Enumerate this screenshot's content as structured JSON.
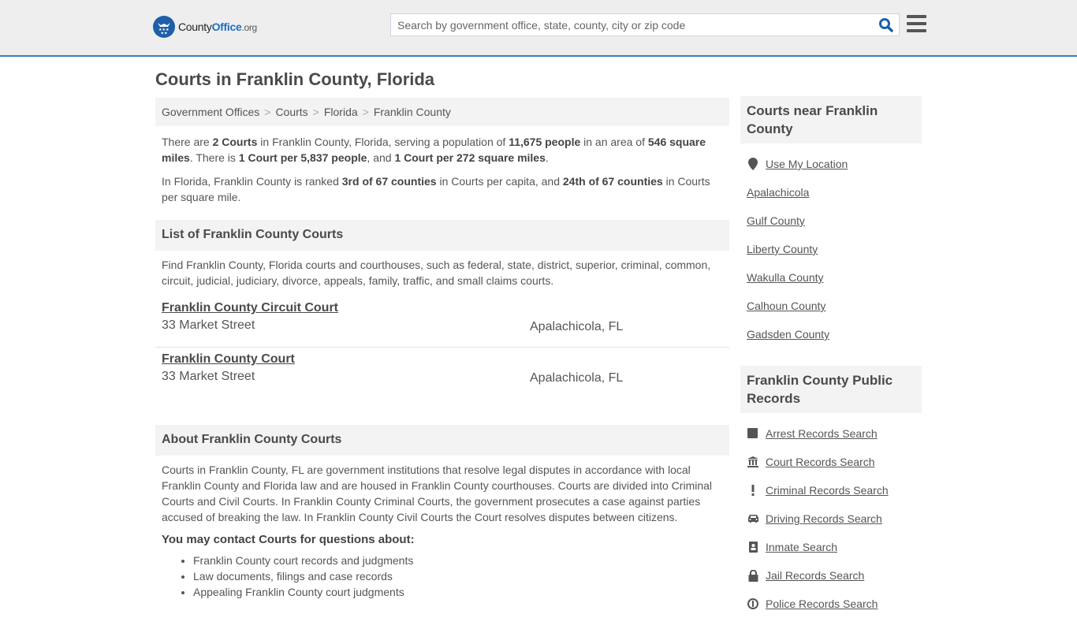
{
  "header": {
    "logo": {
      "part1": "County",
      "part2": "Office",
      "part3": ".org",
      "icon": "eagle-stars-icon",
      "brand_color": "#1d5fa8"
    },
    "search": {
      "placeholder": "Search by government office, state, county, city or zip code",
      "value": "",
      "icon": "search-icon"
    },
    "menu_icon": "hamburger-menu-icon",
    "border_color": "#3a7fb5"
  },
  "page": {
    "title": "Courts in Franklin County, Florida",
    "breadcrumb": [
      "Government Offices",
      "Courts",
      "Florida",
      "Franklin County"
    ],
    "summary": {
      "p1": {
        "t1": "There are ",
        "b1": "2 Courts",
        "t2": " in Franklin County, Florida, serving a population of ",
        "b2": "11,675 people",
        "t3": " in an area of ",
        "b3": "546 square miles",
        "t4": ". There is ",
        "b4": "1 Court per 5,837 people",
        "t5": ", and ",
        "b5": "1 Court per 272 square miles",
        "t6": "."
      },
      "p2": {
        "t1": "In Florida, Franklin County is ranked ",
        "b1": "3rd of 67 counties",
        "t2": " in Courts per capita, and ",
        "b2": "24th of 67 counties",
        "t3": " in Courts per square mile."
      }
    },
    "list_section": {
      "heading": "List of Franklin County Courts",
      "description": "Find Franklin County, Florida courts and courthouses, such as federal, state, district, superior, criminal, common, circuit, judicial, judiciary, divorce, appeals, family, traffic, and small claims courts.",
      "courts": [
        {
          "name": "Franklin County Circuit Court",
          "address": "33 Market Street",
          "city": "Apalachicola, FL"
        },
        {
          "name": "Franklin County Court",
          "address": "33 Market Street",
          "city": "Apalachicola, FL"
        }
      ]
    },
    "about_section": {
      "heading": "About Franklin County Courts",
      "body": "Courts in Franklin County, FL are government institutions that resolve legal disputes in accordance with local Franklin County and Florida law and are housed in Franklin County courthouses. Courts are divided into Criminal Courts and Civil Courts. In Franklin County Criminal Courts, the government prosecutes a case against parties accused of breaking the law. In Franklin County Civil Courts the Court resolves disputes between citizens.",
      "contact_heading": "You may contact Courts for questions about:",
      "contact_items": [
        "Franklin County court records and judgments",
        "Law documents, filings and case records",
        "Appealing Franklin County court judgments"
      ]
    }
  },
  "sidebar": {
    "nearby": {
      "heading": "Courts near Franklin County",
      "use_location": {
        "label": "Use My Location",
        "icon": "map-marker-icon"
      },
      "links": [
        "Apalachicola",
        "Gulf County",
        "Liberty County",
        "Wakulla County",
        "Calhoun County",
        "Gadsden County"
      ]
    },
    "records": {
      "heading": "Franklin County Public Records",
      "links": [
        {
          "label": "Arrest Records Search",
          "icon": "square-icon"
        },
        {
          "label": "Court Records Search",
          "icon": "courthouse-icon"
        },
        {
          "label": "Criminal Records Search",
          "icon": "exclamation-icon"
        },
        {
          "label": "Driving Records Search",
          "icon": "car-icon"
        },
        {
          "label": "Inmate Search",
          "icon": "id-badge-icon"
        },
        {
          "label": "Jail Records Search",
          "icon": "lock-icon"
        },
        {
          "label": "Police Records Search",
          "icon": "police-badge-icon"
        }
      ]
    }
  }
}
